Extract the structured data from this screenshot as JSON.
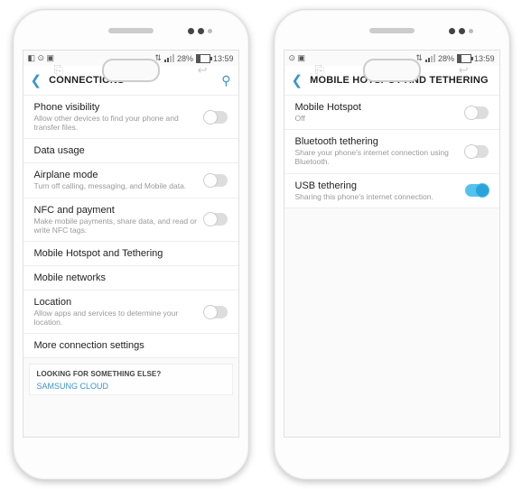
{
  "left": {
    "status": {
      "icons_left": "◧ ⊙ ▣",
      "net": "⇅",
      "signal": true,
      "battery": "28%",
      "time": "13:59"
    },
    "header": {
      "title": "CONNECTIONS"
    },
    "rows": [
      {
        "title": "Phone visibility",
        "sub": "Allow other devices to find your phone and transfer files.",
        "toggle": "off"
      },
      {
        "title": "Data usage",
        "sub": "",
        "toggle": ""
      },
      {
        "title": "Airplane mode",
        "sub": "Turn off calling, messaging, and Mobile data.",
        "toggle": "off"
      },
      {
        "title": "NFC and payment",
        "sub": "Make mobile payments, share data, and read or write NFC tags.",
        "toggle": "off"
      },
      {
        "title": "Mobile Hotspot and Tethering",
        "sub": "",
        "toggle": ""
      },
      {
        "title": "Mobile networks",
        "sub": "",
        "toggle": ""
      },
      {
        "title": "Location",
        "sub": "Allow apps and services to determine your location.",
        "toggle": "off"
      },
      {
        "title": "More connection settings",
        "sub": "",
        "toggle": ""
      }
    ],
    "footer": {
      "title": "LOOKING FOR SOMETHING ELSE?",
      "link": "SAMSUNG CLOUD"
    }
  },
  "right": {
    "status": {
      "icons_left": "⊙ ▣",
      "net": "⇅",
      "signal": true,
      "battery": "28%",
      "time": "13:59"
    },
    "header": {
      "title": "MOBILE HOTSPOT AND TETHERING"
    },
    "rows": [
      {
        "title": "Mobile Hotspot",
        "sub": "Off",
        "toggle": "off"
      },
      {
        "title": "Bluetooth tethering",
        "sub": "Share your phone's internet connection using Bluetooth.",
        "toggle": "off"
      },
      {
        "title": "USB tethering",
        "sub": "Sharing this phone's internet connection.",
        "toggle": "on"
      }
    ]
  }
}
